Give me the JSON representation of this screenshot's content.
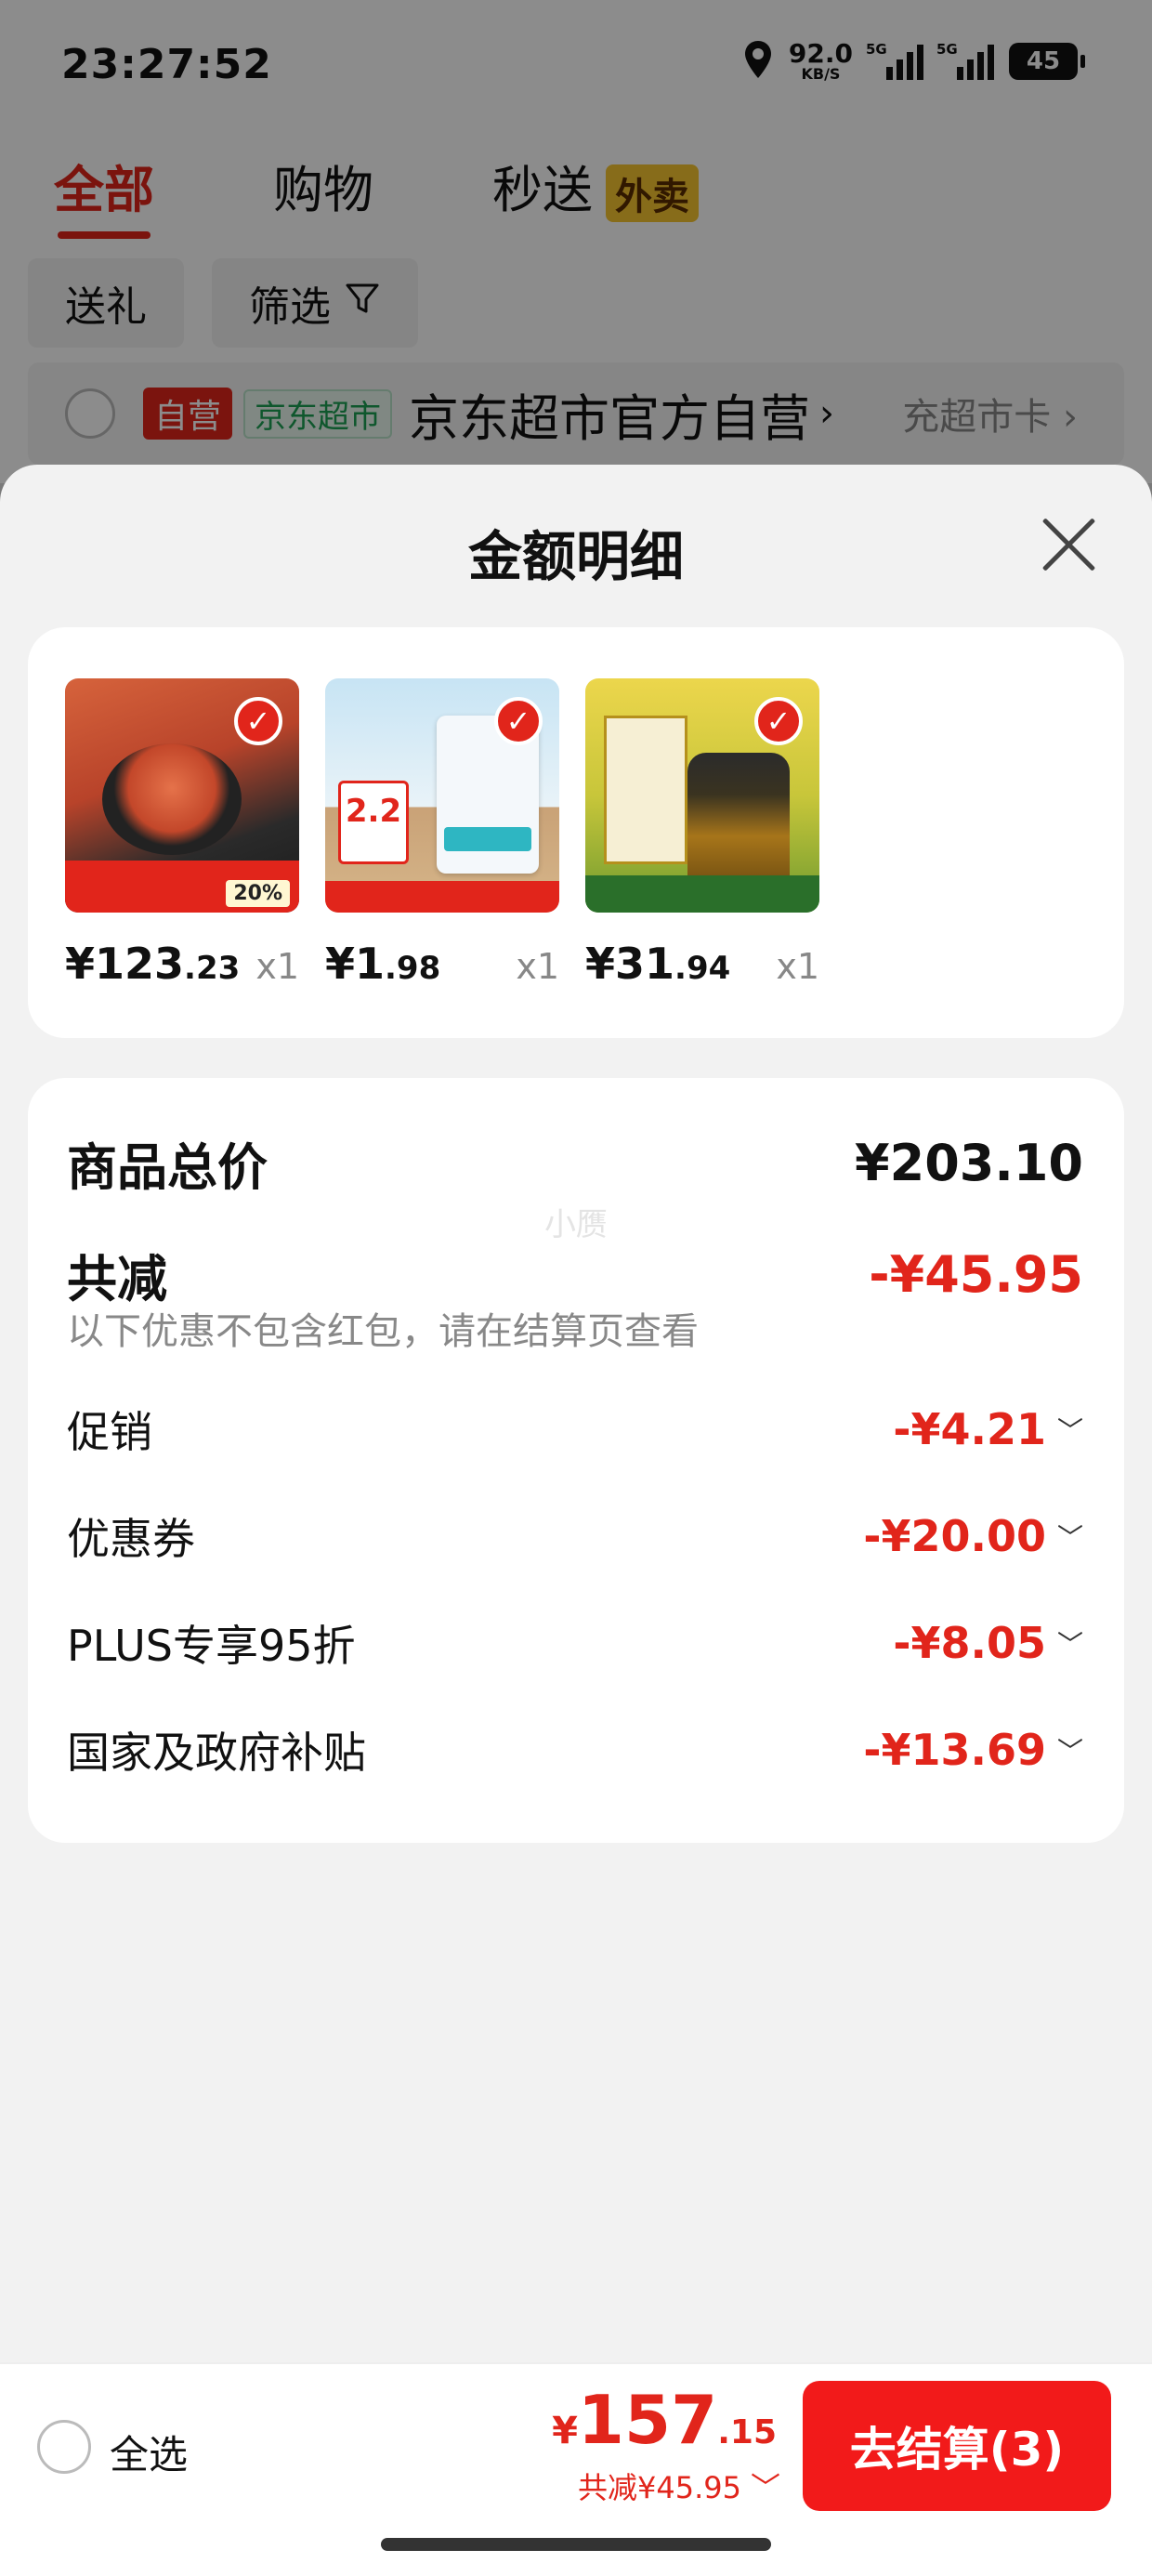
{
  "status_bar": {
    "time": "23:27:52",
    "net_speed": "92.0",
    "net_unit": "KB/S",
    "signal1_label": "5G",
    "signal2_label": "5G",
    "battery": "45"
  },
  "tabs": [
    {
      "label": "全部",
      "active": true
    },
    {
      "label": "购物",
      "active": false
    },
    {
      "label": "秒送",
      "active": false,
      "badge": "外卖"
    }
  ],
  "chips": {
    "gift": "送礼",
    "filter": "筛选"
  },
  "shop": {
    "tag_self": "自营",
    "tag_market": "京东超市",
    "name": "京东超市官方自营",
    "card_link": "充超市卡"
  },
  "sheet": {
    "title": "金额明细",
    "products": [
      {
        "price_int": "¥123",
        "price_dec": ".23",
        "qty": "x1",
        "badge_pct": "20%"
      },
      {
        "price_int": "¥1",
        "price_dec": ".98",
        "qty": "x1",
        "badge_price": "2.2"
      },
      {
        "price_int": "¥31",
        "price_dec": ".94",
        "qty": "x1"
      }
    ],
    "summary": {
      "total_label": "商品总价",
      "total_value": "¥203.10",
      "discount_label": "共减",
      "discount_value": "-¥45.95",
      "note": "以下优惠不包含红包，请在结算页查看",
      "watermark": "小赝",
      "items": [
        {
          "label": "促销",
          "value": "-¥4.21"
        },
        {
          "label": "优惠券",
          "value": "-¥20.00"
        },
        {
          "label": "PLUS专享95折",
          "value": "-¥8.05"
        },
        {
          "label": "国家及政府补贴",
          "value": "-¥13.69"
        }
      ]
    }
  },
  "bottom": {
    "select_all": "全选",
    "currency": "¥",
    "total_main": "157",
    "total_dec": ".15",
    "saved": "共减¥45.95",
    "checkout": "去结算(3)"
  },
  "colors": {
    "accent": "#e1251b",
    "checkout": "#f21a1a"
  }
}
